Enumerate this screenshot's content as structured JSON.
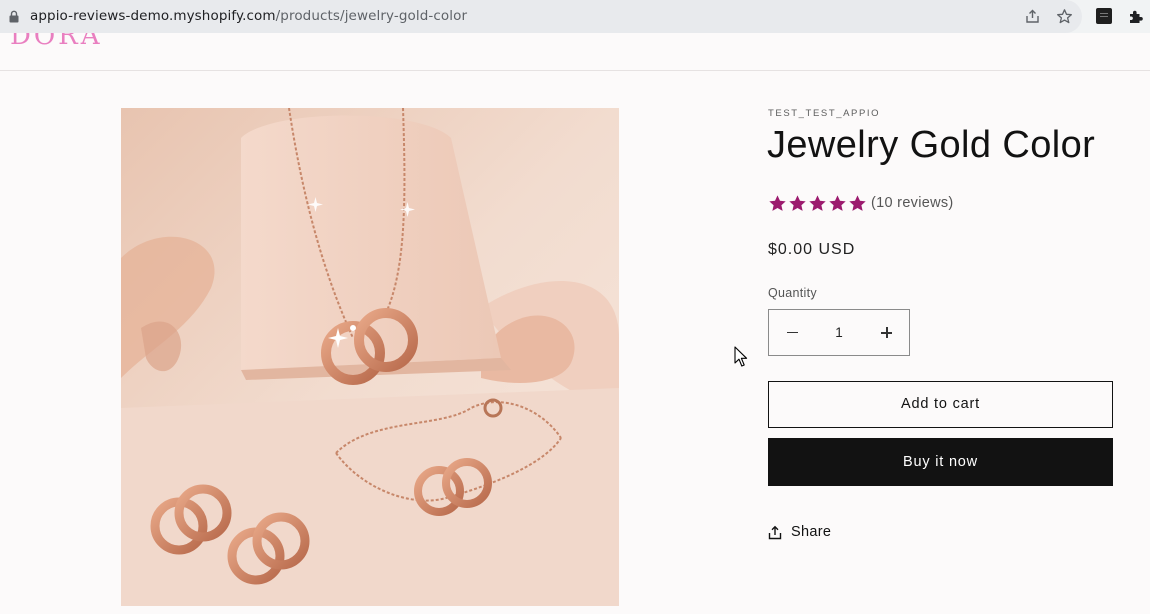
{
  "browser": {
    "url_domain": "appio-reviews-demo.myshopify.com",
    "url_path": "/products/jewelry-gold-color"
  },
  "store": {
    "logo_text": "DORA"
  },
  "product": {
    "vendor": "TEST_TEST_APPIO",
    "title": "Jewelry Gold Color",
    "rating": 5,
    "reviews_text": "(10 reviews)",
    "price": "$0.00 USD",
    "quantity_label": "Quantity",
    "quantity_value": "1",
    "add_to_cart_label": "Add to cart",
    "buy_now_label": "Buy it now",
    "share_label": "Share",
    "image_icon": "jewelry-photo"
  },
  "colors": {
    "star": "#9c1a6e",
    "button_dark": "#121212",
    "logo_pink": "#e97fc0"
  }
}
